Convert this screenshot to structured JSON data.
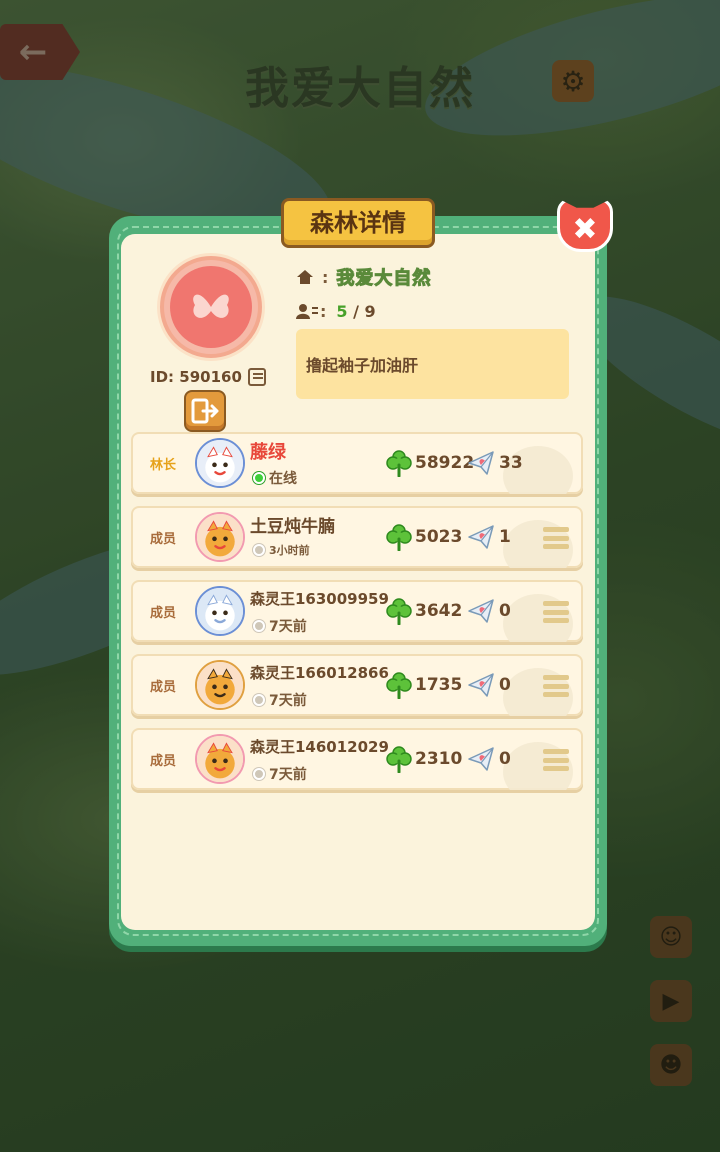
{
  "background": {
    "title": "我爱大自然",
    "back_icon": "arrow-left-icon",
    "settings_icon": "gear-icon",
    "side_buttons": [
      "chat-icon",
      "megaphone-icon",
      "contact-card-icon"
    ]
  },
  "panel": {
    "title": "森林详情",
    "close_icon": "close-icon"
  },
  "forest": {
    "id_label": "ID: 590160",
    "name": "我爱大自然",
    "name_colon": ":",
    "members_current": "5",
    "members_sep": "/",
    "members_max": "9",
    "members_colon": ":",
    "description": "撸起袖子加油肝"
  },
  "members": [
    {
      "role": "林长",
      "name": "藤绿",
      "status": "在线",
      "online": true,
      "clover": "58922",
      "hearts": "33",
      "has_menu": false
    },
    {
      "role": "成员",
      "name": "土豆炖牛腩",
      "status": "3小时前",
      "online": false,
      "clover": "5023",
      "hearts": "1",
      "has_menu": true
    },
    {
      "role": "成员",
      "name": "森灵王163009959",
      "status": "7天前",
      "online": false,
      "clover": "3642",
      "hearts": "0",
      "has_menu": true
    },
    {
      "role": "成员",
      "name": "森灵王166012866",
      "status": "7天前",
      "online": false,
      "clover": "1735",
      "hearts": "0",
      "has_menu": true
    },
    {
      "role": "成员",
      "name": "森灵王146012029",
      "status": "7天前",
      "online": false,
      "clover": "2310",
      "hearts": "0",
      "has_menu": true
    }
  ],
  "colors": {
    "panel_green": "#51b07a",
    "panel_cream": "#fbf3dc",
    "title_gold": "#f5c341",
    "leader_red": "#e8473a",
    "online_green": "#3fcf3a"
  }
}
